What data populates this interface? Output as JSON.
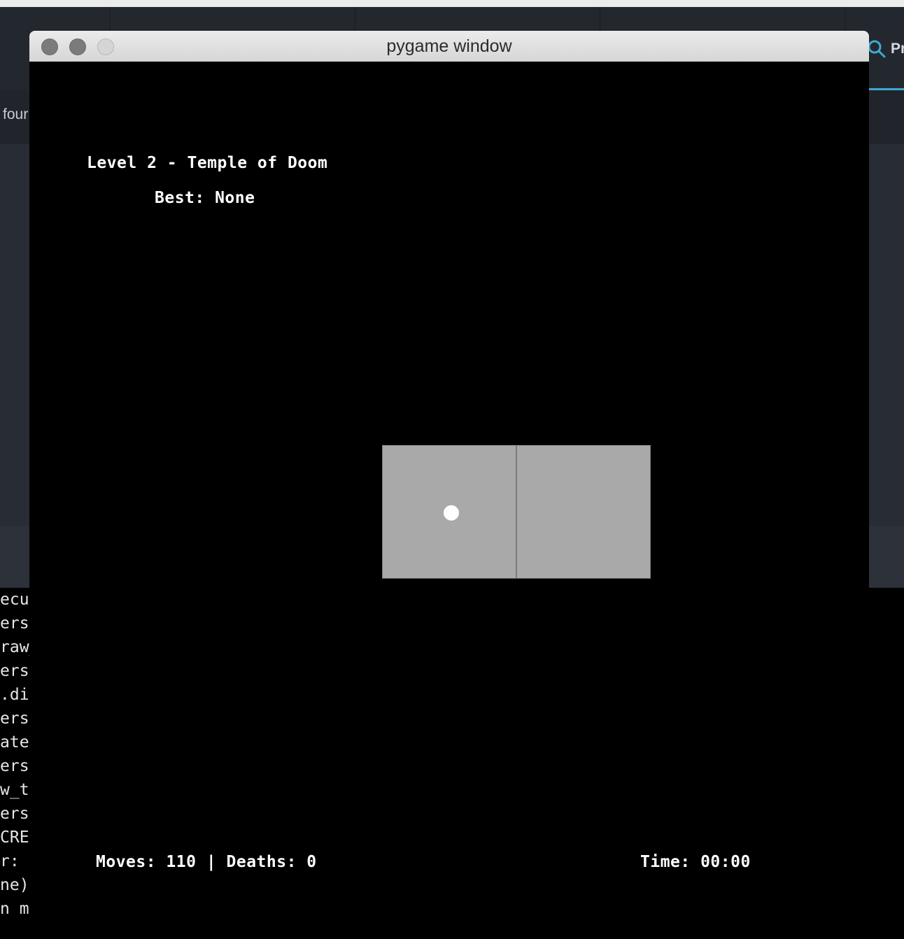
{
  "background_ide": {
    "tab_label": "four",
    "search_label": "Pr",
    "terminal_lines": [
      "ecut",
      "ers/",
      "raw_",
      "ers/",
      ".di",
      "ers/",
      "ate",
      "ers/",
      "w_t",
      "ers/",
      "CRE",
      "r: d",
      "ne)",
      "n main.py"
    ]
  },
  "window": {
    "title": "pygame window"
  },
  "game": {
    "level_title": "Level 2 - Temple of Doom",
    "best": "Best: None",
    "stats": "Moves: 110 | Deaths: 0",
    "time": "Time: 00:00",
    "colors": {
      "background": "#000000",
      "tile": "#a9a9a9",
      "player": "#ffffff",
      "text": "#ffffff"
    }
  }
}
